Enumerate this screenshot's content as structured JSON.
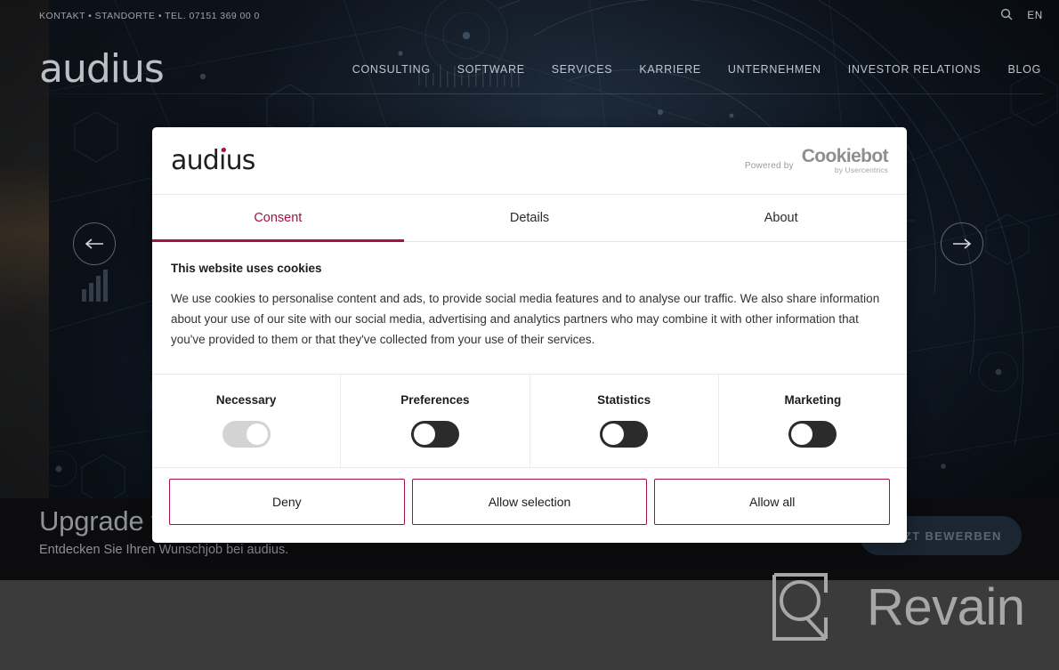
{
  "site": {
    "topbar": {
      "contact_line": "KONTAKT • STANDORTE • TEL. 07151 369 00 0",
      "search_icon": "search-icon",
      "language": "EN"
    },
    "brand": "audius",
    "nav": [
      {
        "label": "CONSULTING"
      },
      {
        "label": "SOFTWARE"
      },
      {
        "label": "SERVICES"
      },
      {
        "label": "KARRIERE"
      },
      {
        "label": "UNTERNEHMEN"
      },
      {
        "label": "INVESTOR RELATIONS"
      },
      {
        "label": "BLOG"
      }
    ],
    "carousel": {
      "prev_icon": "arrow-left-icon",
      "next_icon": "arrow-right-icon"
    },
    "banner": {
      "title": "Upgrade your career",
      "subtitle": "Entdecken Sie Ihren Wunschjob bei audius.",
      "cta_label": "JETZT BEWERBEN"
    }
  },
  "watermark": {
    "text": "Revain",
    "icon": "revain-logo-icon"
  },
  "dialog": {
    "logo": "audius",
    "powered_by_label": "Powered by",
    "provider_name": "Cookiebot",
    "provider_sub": "by Usercentrics",
    "tabs": [
      {
        "label": "Consent",
        "active": true
      },
      {
        "label": "Details",
        "active": false
      },
      {
        "label": "About",
        "active": false
      }
    ],
    "body": {
      "title": "This website uses cookies",
      "text": "We use cookies to personalise content and ads, to provide social media features and to analyse our traffic. We also share information about your use of our site with our social media, advertising and analytics partners who may combine it with other information that you've provided to them or that they've collected from your use of their services."
    },
    "categories": [
      {
        "label": "Necessary",
        "state": "locked-on"
      },
      {
        "label": "Preferences",
        "state": "off"
      },
      {
        "label": "Statistics",
        "state": "off"
      },
      {
        "label": "Marketing",
        "state": "off"
      }
    ],
    "actions": [
      {
        "label": "Deny"
      },
      {
        "label": "Allow selection"
      },
      {
        "label": "Allow all"
      }
    ]
  },
  "colors": {
    "accent": "#a4123f",
    "dialog_bg": "#ffffff",
    "hero_bg": "#0b1018",
    "footer_bg": "#3b3b3b",
    "toggle_off": "#2b2b2b",
    "toggle_locked": "#d3d3d3"
  }
}
